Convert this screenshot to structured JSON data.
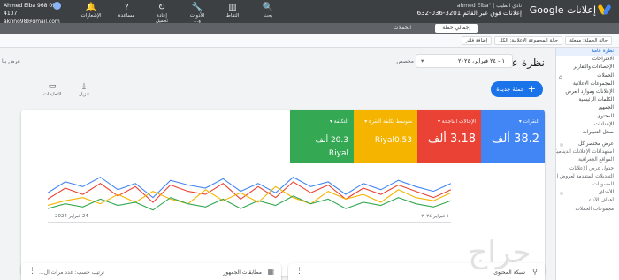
{
  "topbar": {
    "brand": "إعلانات Google",
    "account_line1": "نادي الطيب | \"ahmed Elba ",
    "account_line2": "إعلانات فوق عبر القائم 3201-036-632",
    "icons": [
      {
        "name": "search-icon",
        "glyph": "🔍",
        "label": "بحث"
      },
      {
        "name": "chart-icon",
        "glyph": "▥",
        "label": "التقاط"
      },
      {
        "name": "tools-icon",
        "glyph": "🔧",
        "label": "الأدوات و..."
      },
      {
        "name": "refresh-icon",
        "glyph": "↻",
        "label": "إعادة تحميل"
      },
      {
        "name": "help-icon",
        "glyph": "?",
        "label": "مساعدة"
      },
      {
        "name": "bell-icon",
        "glyph": "🔔",
        "label": "الإشعارات"
      }
    ],
    "left_line1": "Ahmed Elba 968 092 4107",
    "left_line2": "akrino98@gmail.com",
    "chip_active": "إجمالي حملة",
    "chip_other": "الحملات"
  },
  "filters": [
    "حالة الحملة: مفعلة",
    "حالة المجموعة الإعلانية: الكل",
    "إضافة فلتر"
  ],
  "sidebar": {
    "items": [
      {
        "label": "نظرة عامة",
        "active": true
      },
      {
        "label": "الاقتراحات"
      },
      {
        "label": "الإحصاءات والتقارير"
      },
      {
        "label": "الحملات",
        "home": true
      },
      {
        "label": "المجموعات الإعلانية"
      },
      {
        "label": "الإعلانات وموارد العرض"
      },
      {
        "label": "الكلمات الرئيسية"
      },
      {
        "label": "الجمهور"
      },
      {
        "label": "المحتوى"
      },
      {
        "label": "الإعدادات"
      },
      {
        "label": "سجل التغييرات"
      },
      {
        "label": "عرض مختصر كل",
        "gap": true,
        "dot": true
      },
      {
        "label": "استهدافات الإعلانات الديناميكية",
        "sub": true
      },
      {
        "label": "المواقع الجغرافية",
        "sub": true
      },
      {
        "label": "جدول عرض الإعلانات",
        "sub": true
      },
      {
        "label": "التعديلات المتقدمة لعروض الأسعار",
        "sub": true
      },
      {
        "label": "المسودات",
        "sub": true
      },
      {
        "label": "الأهداف",
        "dot": true
      },
      {
        "label": "أهداف الأداء",
        "sub": true
      },
      {
        "label": "مجموعات الحملات",
        "sub": true
      }
    ]
  },
  "main": {
    "title": "نظرة عامة",
    "date_label": "مخصص",
    "date_range": "١ - ٢٤ فبراير، ٢٠٢٤",
    "show_as": "عرض بنا",
    "new_campaign": "حملة جديدة",
    "download": "تنزيل",
    "annotations": "التعليقات"
  },
  "metrics": [
    {
      "label": "النقرات",
      "value": "38.2 ألف",
      "color": "#4285f4"
    },
    {
      "label": "الإحالات الناجحة",
      "value": "3.18 ألف",
      "color": "#ea4335"
    },
    {
      "label": "متوسط تكلفة النقرة",
      "value": "Riyal0.53",
      "color": "#f4b400",
      "small": true
    },
    {
      "label": "التكلفة",
      "value": "20.3 ألف Riyal",
      "color": "#34a853",
      "small": true
    }
  ],
  "chart_data": {
    "type": "line",
    "x": [
      "1 فبراير 2024",
      "24 فبراير 2024"
    ],
    "series": [
      {
        "color": "#4285f4",
        "values": [
          34,
          41,
          38,
          44,
          36,
          40,
          31,
          42,
          39,
          37,
          43,
          35,
          40,
          34,
          44,
          38,
          41,
          33,
          40,
          36,
          42,
          38,
          35,
          40
        ]
      },
      {
        "color": "#ea4335",
        "values": [
          30,
          37,
          33,
          40,
          32,
          38,
          28,
          39,
          35,
          33,
          40,
          30,
          38,
          31,
          41,
          34,
          39,
          30,
          37,
          33,
          39,
          35,
          31,
          36
        ]
      },
      {
        "color": "#f4b400",
        "values": [
          26,
          29,
          31,
          27,
          33,
          28,
          35,
          30,
          27,
          36,
          29,
          34,
          28,
          38,
          31,
          27,
          35,
          30,
          33,
          28,
          36,
          31,
          29,
          34
        ]
      },
      {
        "color": "#34a853",
        "values": [
          24,
          27,
          25,
          30,
          26,
          28,
          23,
          31,
          27,
          25,
          30,
          24,
          29,
          26,
          32,
          27,
          30,
          24,
          28,
          26,
          31,
          27,
          25,
          29
        ]
      }
    ],
    "xlabel_start": "١ فبراير ٢٠٢٤",
    "xlabel_end": "24 فبراير 2024",
    "ylim": [
      15,
      50
    ]
  },
  "bottom_cards": [
    {
      "title": "شبكة المحتوى"
    },
    {
      "title": "مطابقات الجمهور",
      "sort": "ترتيب حسب: عدد مرات ال..."
    }
  ],
  "watermark": "حراج"
}
